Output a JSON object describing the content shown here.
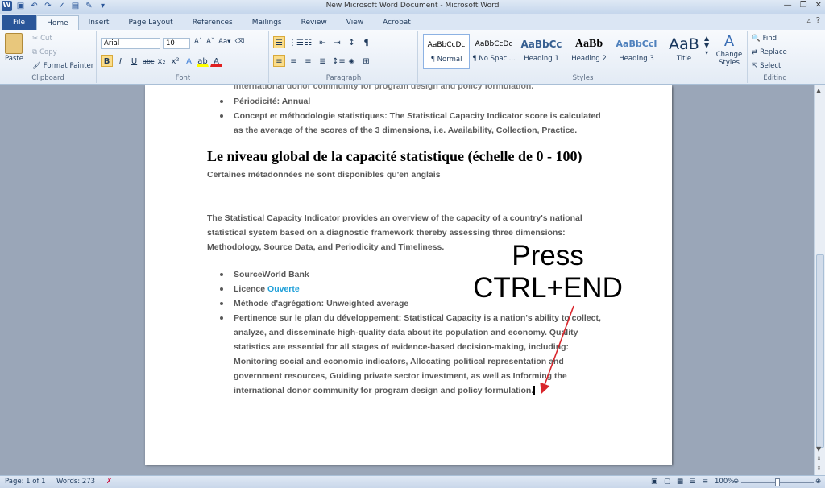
{
  "window": {
    "title": "New Microsoft Word Document  -  Microsoft Word",
    "logo_letter": "W"
  },
  "tabs": [
    "File",
    "Home",
    "Insert",
    "Page Layout",
    "References",
    "Mailings",
    "Review",
    "View",
    "Acrobat"
  ],
  "ribbon": {
    "clipboard": {
      "label": "Clipboard",
      "paste": "Paste",
      "cut": "Cut",
      "copy": "Copy",
      "format_painter": "Format Painter"
    },
    "font": {
      "label": "Font",
      "font_name": "Arial",
      "font_size": "10"
    },
    "paragraph": {
      "label": "Paragraph"
    },
    "styles": {
      "label": "Styles",
      "items": [
        {
          "preview": "AaBbCcDc",
          "name": "¶ Normal"
        },
        {
          "preview": "AaBbCcDc",
          "name": "¶ No Spaci..."
        },
        {
          "preview": "AaBbCc",
          "name": "Heading 1"
        },
        {
          "preview": "AaBb",
          "name": "Heading 2"
        },
        {
          "preview": "AaBbCcI",
          "name": "Heading 3"
        },
        {
          "preview": "AaB",
          "name": "Title"
        }
      ],
      "change_styles": "Change Styles"
    },
    "editing": {
      "label": "Editing",
      "find": "Find",
      "replace": "Replace",
      "select": "Select"
    }
  },
  "document": {
    "cut_line": "international donor community for program design and policy formulation.",
    "bullets_top": [
      "Périodicité: Annual",
      "Concept et méthodologie statistiques: The Statistical Capacity Indicator score is calculated",
      "as the average of the scores of the 3 dimensions, i.e. Availability, Collection, Practice."
    ],
    "heading": "Le niveau global de la capacité statistique (échelle de 0 - 100)",
    "subtitle": "Certaines  métadonnées  ne sont disponibles qu'en anglais",
    "paragraph": [
      "The Statistical Capacity Indicator provides  an overview of the capacity  of a country's  national",
      "statistical  system  based on a diagnostic  framework  thereby  assessing  three dimensions:",
      "Methodology,  Source Data,  and Periodicity and Timeliness."
    ],
    "source": "SourceWorld  Bank",
    "licence_label": "Licence",
    "licence_link": "Ouverte",
    "method": "Méthode  d'agrégation:  Unweighted  average",
    "pertinence": [
      "Pertinence  sur le plan du développement:  Statistical  Capacity  is a nation's ability to collect,",
      "analyze, and disseminate  high-quality  data about its population and economy. Quality",
      "statistics  are essential  for all stages  of evidence-based   decision-making,  including:",
      "Monitoring social and economic indicators, Allocating political representation and",
      "government  resources,  Guiding private sector investment, as well as Informing the",
      "international  donor  community  for program  design  and  policy  formulation."
    ]
  },
  "annotation": {
    "line1": "Press",
    "line2": "CTRL+END",
    "arrow_color": "#d9262c"
  },
  "status": {
    "page": "Page: 1 of 1",
    "words": "Words: 273",
    "zoom": "100%"
  }
}
